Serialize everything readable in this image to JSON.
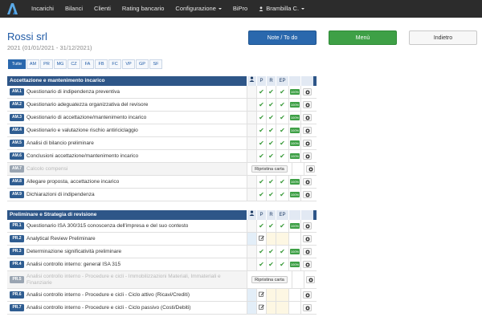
{
  "nav": {
    "items": [
      "Incarichi",
      "Bilanci",
      "Clienti",
      "Rating bancario",
      "Configurazione",
      "BiPro"
    ],
    "user": "Brambilla C."
  },
  "header": {
    "company": "Rossi srl",
    "period": "2021 (01/01/2021 - 31/12/2021)",
    "notes_label": "Note / To do",
    "menu_label": "Menù",
    "back_label": "Indietro"
  },
  "tabs": [
    "Tutte",
    "AM",
    "PR",
    "MG",
    "CZ",
    "FA",
    "FB",
    "FC",
    "VP",
    "GP",
    "SF"
  ],
  "sections": [
    {
      "title": "Accettazione e mantenimento incarico",
      "cols": [
        "P",
        "R",
        "EP"
      ],
      "rows": [
        {
          "code": "AM.1",
          "label": "Questionario di indipendenza preventiva",
          "state": "done"
        },
        {
          "code": "AM.2",
          "label": "Questionario adeguatezza organizzativa del revisore",
          "state": "done"
        },
        {
          "code": "AM.3",
          "label": "Questionario di accettazione/mantenimento incarico",
          "state": "done"
        },
        {
          "code": "AM.4",
          "label": "Questionario e valutazione rischio antiriciclaggio",
          "state": "done"
        },
        {
          "code": "AM.5",
          "label": "Analisi di bilancio preliminare",
          "state": "done"
        },
        {
          "code": "AM.6",
          "label": "Conclusioni accettazione/mantenimento incarico",
          "state": "done"
        },
        {
          "code": "AM.7",
          "label": "Calcolo compensi",
          "state": "disabled"
        },
        {
          "code": "AM.8",
          "label": "Allegare proposta, accettazione incarico",
          "state": "done"
        },
        {
          "code": "AM.9",
          "label": "Dichiarazioni di indipendenza",
          "state": "done"
        }
      ]
    },
    {
      "title": "Preliminare e Strategia di revisione",
      "cols": [
        "P",
        "R",
        "EP"
      ],
      "rows": [
        {
          "code": "PR.1",
          "label": "Questionario ISA 300/315 conoscenza dell'impresa e del suo contesto",
          "state": "done"
        },
        {
          "code": "PR.2",
          "label": "Analytical Review Preliminare",
          "state": "edit"
        },
        {
          "code": "PR.3",
          "label": "Determinazione significatività preliminare",
          "state": "done"
        },
        {
          "code": "PR.4",
          "label": "Analisi controllo interno: general ISA 315",
          "state": "done"
        },
        {
          "code": "PR.5",
          "label": "Analisi controllo interno - Procedure e cicli - Immobilizzazioni Materiali, Immateriali e Finanziarie",
          "state": "disabled"
        },
        {
          "code": "PR.6",
          "label": "Analisi controllo interno - Procedure e cicli - Ciclo attivo (Ricavi/Crediti)",
          "state": "edit"
        },
        {
          "code": "PR.7",
          "label": "Analisi controllo interno - Procedure e cicli - Ciclo passivo (Costi/Debiti)",
          "state": "edit"
        }
      ]
    }
  ],
  "labels": {
    "restore": "Ripristina carta",
    "percent": "100%"
  },
  "colors": {
    "navbar": "#2c2c2c",
    "primary": "#2a68ad",
    "success": "#3ea046",
    "section_header": "#2e5688"
  }
}
